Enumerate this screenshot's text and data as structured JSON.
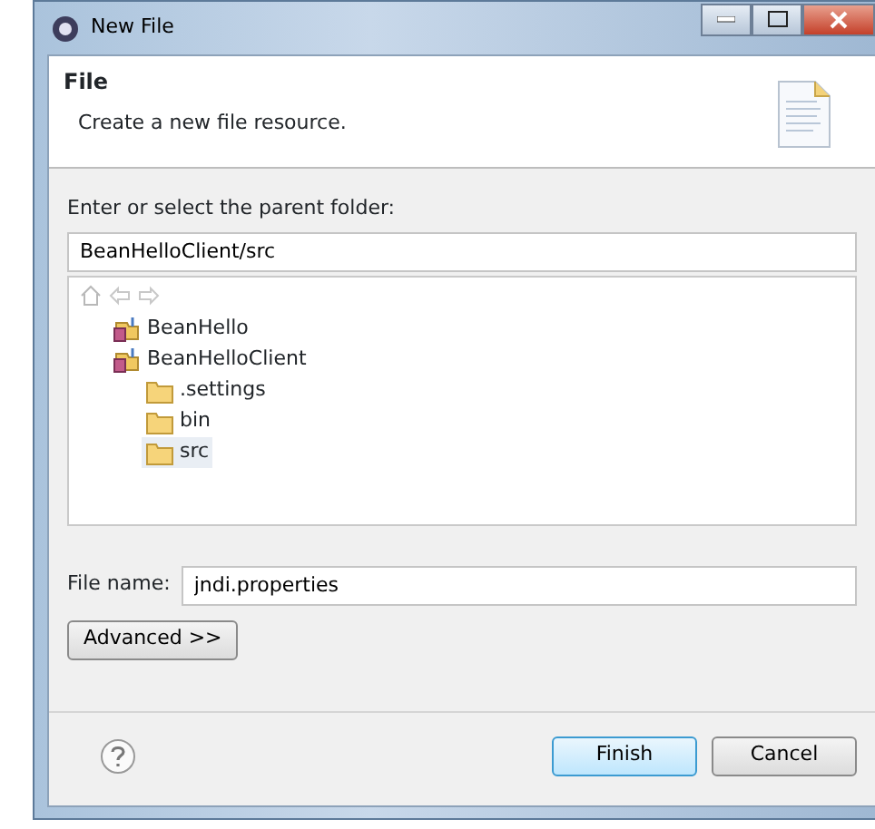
{
  "window": {
    "title": "New File"
  },
  "header": {
    "title": "File",
    "description": "Create a new file resource."
  },
  "folder_label": "Enter or select the parent folder:",
  "folder_value": "BeanHelloClient/src",
  "tree": [
    {
      "label": "BeanHello",
      "kind": "project",
      "selected": false
    },
    {
      "label": "BeanHelloClient",
      "kind": "project",
      "selected": false,
      "children": [
        {
          "label": ".settings",
          "kind": "folder",
          "selected": false
        },
        {
          "label": "bin",
          "kind": "folder",
          "selected": false
        },
        {
          "label": "src",
          "kind": "folder",
          "selected": true
        }
      ]
    }
  ],
  "file_name_label": "File name:",
  "file_name_value": "jndi.properties",
  "advanced_button": "Advanced >>",
  "buttons": [
    {
      "label": "Finish",
      "default": true
    },
    {
      "label": "Cancel",
      "default": false
    }
  ]
}
